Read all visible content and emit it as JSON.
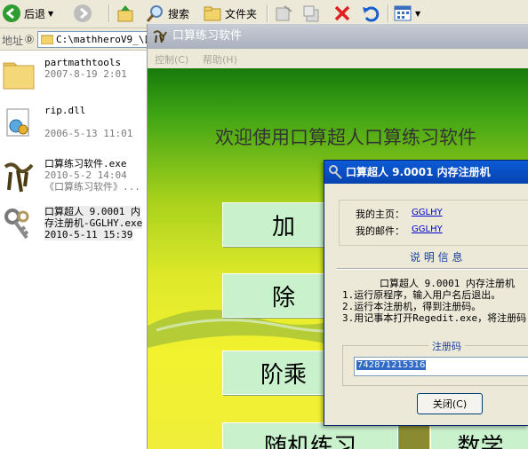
{
  "toolbar": {
    "back_label": "后退",
    "search_label": "搜索",
    "folders_label": "文件夹"
  },
  "address": {
    "label": "地址",
    "path": "C:\\mathheroV9_\\口"
  },
  "files": [
    {
      "name": "partmathtools",
      "line2": "2007-8-19 2:01",
      "line3": ""
    },
    {
      "name": "rip.dll",
      "line2": "2006-5-13 11:01",
      "line3": ""
    },
    {
      "name": "口算练习软件.exe",
      "line2": "2010-5-2 14:04",
      "line3": "《口算练习软件》..."
    },
    {
      "name": "口算超人 9.0001 内",
      "line2": "存注册机-GGLHY.exe",
      "line3": "2010-5-11 15:39"
    }
  ],
  "app": {
    "title": "口算练习软件",
    "menu": [
      "控制(C)",
      "帮助(H)"
    ],
    "welcome": "欢迎使用口算超人口算练习软件",
    "buttons": [
      "加",
      "除",
      "阶乘",
      "随机练习",
      "数学"
    ]
  },
  "dialog": {
    "title": "口算超人 9.0001 内存注册机",
    "homepage_label": "我的主页：",
    "homepage_value": "GGLHY",
    "email_label": "我的邮件：",
    "email_value": "GGLHY",
    "instructions_title": "说 明 信 息",
    "instructions": [
      "口算超人 9.0001 内存注册机",
      "1.运行原程序，输入用户名后退出。",
      "2.运行本注册机，得到注册码。",
      "3.用记事本打开Regedit.exe，将注册码"
    ],
    "regcode_label": "注册码",
    "regcode_value": "742871215316",
    "close_label": "关闭(C)"
  }
}
